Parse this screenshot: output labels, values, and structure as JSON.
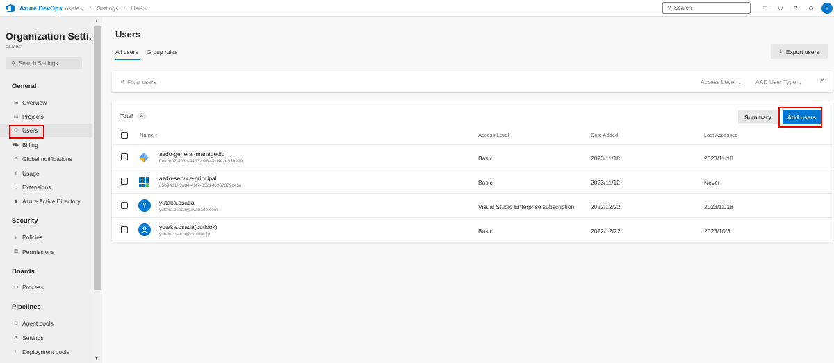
{
  "header": {
    "brand": "Azure DevOps",
    "breadcrumbs": [
      "osatest",
      "Settings",
      "Users"
    ],
    "separator": "/",
    "search_placeholder": "Search",
    "avatar_initial": "Y"
  },
  "sidebar": {
    "title": "Organization Setti...",
    "subtitle": "osatest",
    "search_placeholder": "Search Settings",
    "sections": {
      "general": "General",
      "security": "Security",
      "boards": "Boards",
      "pipelines": "Pipelines"
    },
    "items": {
      "overview": "Overview",
      "projects": "Projects",
      "users": "Users",
      "billing": "Billing",
      "global_notifications": "Global notifications",
      "usage": "Usage",
      "extensions": "Extensions",
      "aad": "Azure Active Directory",
      "policies": "Policies",
      "permissions": "Permissions",
      "process": "Process",
      "agent_pools": "Agent pools",
      "settings": "Settings",
      "deployment_pools": "Deployment pools"
    },
    "active_item": "users"
  },
  "main": {
    "title": "Users",
    "tabs": [
      "All users",
      "Group rules"
    ],
    "active_tab": "All users",
    "export_label": "Export users",
    "filter": {
      "placeholder": "Filter users",
      "access_level": "Access Level",
      "aad_user_type": "AAD User Type"
    },
    "total_label": "Total",
    "total_count": "4",
    "summary_label": "Summary",
    "add_users_label": "Add users",
    "columns": {
      "name": "Name ↑",
      "access_level": "Access Level",
      "date_added": "Date Added",
      "last_accessed": "Last Accessed"
    },
    "rows": [
      {
        "name": "azdo-general-managedid",
        "sub": "ffeacb07-403b-4463-b98e-2d4e2e55be99",
        "access": "Basic",
        "added": "2023/11/18",
        "last": "2023/11/18"
      },
      {
        "name": "azdo-service-principal",
        "sub": "d5b94d1f-9a84-4f47-8021-f6967879ce5e",
        "access": "Basic",
        "added": "2023/11/12",
        "last": "Never"
      },
      {
        "name": "yutaka.osada",
        "sub": "yutaka.osada@avanade.com",
        "access": "Visual Studio Enterprise subscription",
        "added": "2022/12/22",
        "last": "2023/11/18",
        "avatar_initial": "Y"
      },
      {
        "name": "yutaka.osada(outlook)",
        "sub": "yutaka.osada@outlook.jp",
        "access": "Basic",
        "added": "2022/12/22",
        "last": "2023/10/3"
      }
    ]
  },
  "colors": {
    "accent": "#0078d4",
    "highlight": "#ee0000"
  }
}
